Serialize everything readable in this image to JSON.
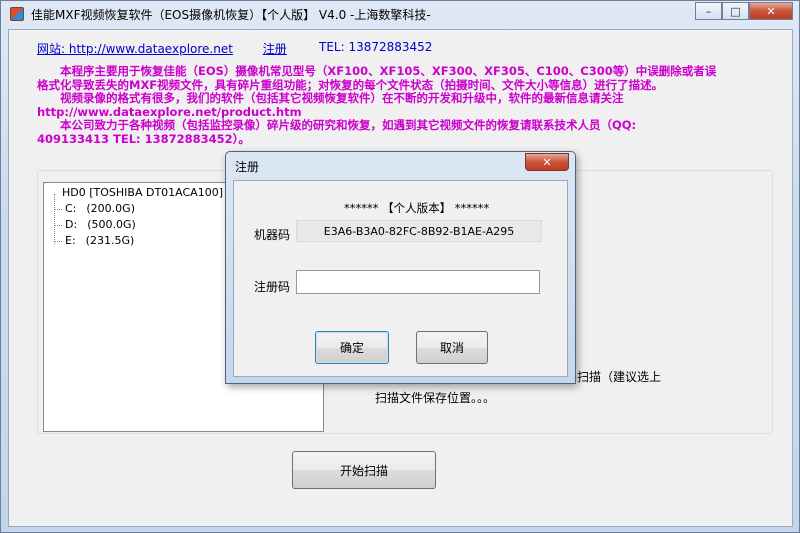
{
  "window": {
    "title": "佳能MXF视频恢复软件（EOS摄像机恢复）【个人版】 V4.0  -上海数擎科技-",
    "minimize": "–",
    "maximize": "□",
    "close": "✕"
  },
  "links": {
    "website": "网站: http://www.dataexplore.net",
    "register": "注册",
    "tel": "TEL: 13872883452"
  },
  "description": [
    "　　本程序主要用于恢复佳能（EOS）摄像机常见型号（XF100、XF105、XF300、XF305、C100、C300等）中误删除或者误",
    "格式化导致丢失的MXF视频文件，具有碎片重组功能；对恢复的每个文件状态（拍摄时间、文件大小等信息）进行了描述。",
    "　　视频录像的格式有很多，我们的软件（包括其它视频恢复软件）在不断的开发和升级中，软件的最新信息请关注",
    "http://www.dataexplore.net/product.htm",
    "　　本公司致力于各种视频（包括监控录像）碎片级的研究和恢复，如遇到其它视频文件的恢复请联系技术人员（QQ:",
    "409133413  TEL: 13872883452）。"
  ],
  "tree": {
    "disk": "HD0    [TOSHIBA DT01ACA100]  (",
    "drives": [
      {
        "letter": "C:",
        "size": "(200.0G)"
      },
      {
        "letter": "D:",
        "size": "(500.0G)"
      },
      {
        "letter": "E:",
        "size": "(231.5G)"
      }
    ]
  },
  "hints": {
    "scan": "扫描（建议选上",
    "save": "扫描文件保存位置。。。"
  },
  "start_button": "开始扫描",
  "dialog": {
    "title": "注册",
    "close": "✕",
    "edition": "****** 【个人版本】 ******",
    "machine_code_label": "机器码",
    "machine_code": "E3A6-B3A0-82FC-8B92-B1AE-A295",
    "reg_code_label": "注册码",
    "reg_code_value": "",
    "ok": "确定",
    "cancel": "取消"
  }
}
